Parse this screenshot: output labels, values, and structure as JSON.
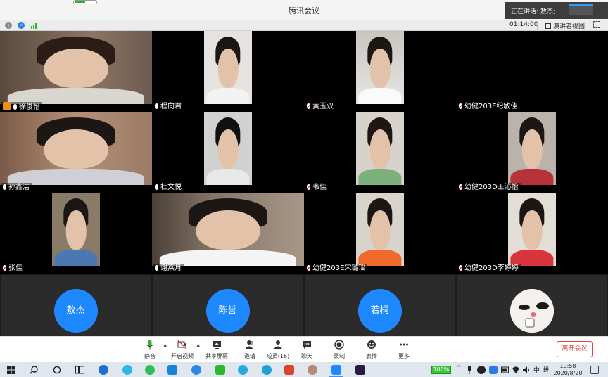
{
  "window": {
    "title": "腾讯会议"
  },
  "speaking": {
    "text": "正在讲话: 敖杰;"
  },
  "info_bar": {
    "timer": "01:14:00",
    "view_mode": "演讲者视图"
  },
  "participants": [
    {
      "name": "徐俊怡",
      "host": true,
      "muted": false
    },
    {
      "name": "程向君",
      "host": false,
      "muted": false
    },
    {
      "name": "黄玉双",
      "host": false,
      "muted": true
    },
    {
      "name": "幼健203E纪敏佳",
      "host": false,
      "muted": true
    },
    {
      "name": "孙鑫洁",
      "host": false,
      "muted": false
    },
    {
      "name": "杜文悦",
      "host": false,
      "muted": false
    },
    {
      "name": "韦佳",
      "host": false,
      "muted": true
    },
    {
      "name": "幼健203D王沁怡",
      "host": false,
      "muted": true
    },
    {
      "name": "张佳",
      "host": false,
      "muted": true
    },
    {
      "name": "谢燕月",
      "host": false,
      "muted": false
    },
    {
      "name": "幼健203E宋璐瑶",
      "host": false,
      "muted": true
    },
    {
      "name": "幼健203D李婷婷",
      "host": false,
      "muted": true
    }
  ],
  "avatars": [
    {
      "name": "敖杰"
    },
    {
      "name": "陈誉"
    },
    {
      "name": "若桐"
    }
  ],
  "toolbar": {
    "mute": "静音",
    "video": "开启视频",
    "share": "共享屏幕",
    "invite": "邀请",
    "members": "成员(16)",
    "chat": "聊天",
    "record": "录制",
    "emoji": "表情",
    "more": "更多",
    "leave": "离开会议"
  },
  "taskbar": {
    "battery": "100%",
    "ime": "中",
    "ime2": "拼",
    "time": "19:58",
    "date": "2020/8/20"
  },
  "colors": {
    "accent": "#1e88ff",
    "leave": "#e64545",
    "muted": "#e33333"
  }
}
